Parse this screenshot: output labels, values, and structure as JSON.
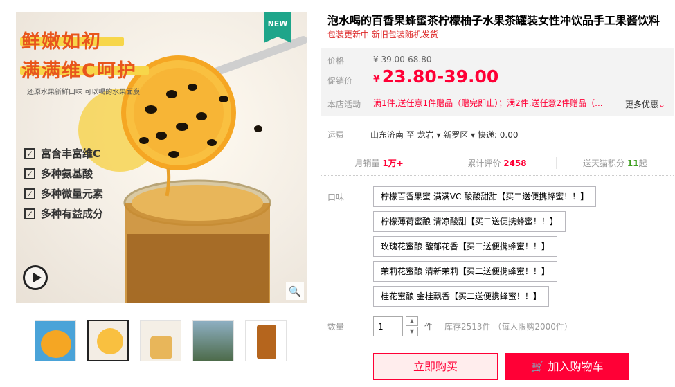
{
  "gallery": {
    "badge": "NEW",
    "headline_1": "鲜嫩如初",
    "headline_2": "满满维C呵护",
    "slogan": "还原水果新鲜口味  可以喝的水果面膜",
    "features": [
      "富含丰富维C",
      "多种氨基酸",
      "多种微量元素",
      "多种有益成分"
    ],
    "zoom_glyph": "🔍",
    "thumb_count": 5,
    "active_thumb": 2
  },
  "product": {
    "title": "泡水喝的百香果蜂蜜茶柠檬柚子水果茶罐装女性冲饮品手工果酱饮料",
    "subtitle": "包装更新中 新旧包装随机发货"
  },
  "price": {
    "orig_label": "价格",
    "orig_value": "¥ 39.00-68.80",
    "promo_label": "促销价",
    "currency": "¥",
    "promo_value": "23.80-39.00",
    "activity_label": "本店活动",
    "activity_text": "满1件,送任意1件赠品（赠完即止）；满2件,送任意2件赠品（...",
    "more_label": "更多优惠"
  },
  "shipping": {
    "label": "运费",
    "value": "山东济南  至  龙岩 ▾ 新罗区 ▾  快递: 0.00"
  },
  "stats": {
    "sales_label": "月销量",
    "sales_value": "1万+",
    "reviews_label": "累计评价",
    "reviews_value": "2458",
    "points_label": "送天猫积分",
    "points_value": "11",
    "points_unit": "起"
  },
  "options": {
    "label": "口味",
    "items": [
      "柠檬百香果蜜 满满VC 酸酸甜甜【买二送便携蜂蜜！！】",
      "柠檬薄荷蜜酿 清凉酸甜【买二送便携蜂蜜！！】",
      "玫瑰花蜜酿 馥郁花香【买二送便携蜂蜜！！】",
      "茉莉花蜜酿 清新茉莉【买二送便携蜂蜜！！】",
      "桂花蜜酿 金桂飘香【买二送便携蜂蜜！！】"
    ]
  },
  "quantity": {
    "label": "数量",
    "value": "1",
    "unit": "件",
    "stock": "库存2513件  （每人限购2000件）"
  },
  "actions": {
    "buy_label": "立即购买",
    "cart_label": "加入购物车"
  },
  "colors": {
    "accent": "#ff0036",
    "badge": "#1ea58a",
    "headline": "#e8551c"
  }
}
